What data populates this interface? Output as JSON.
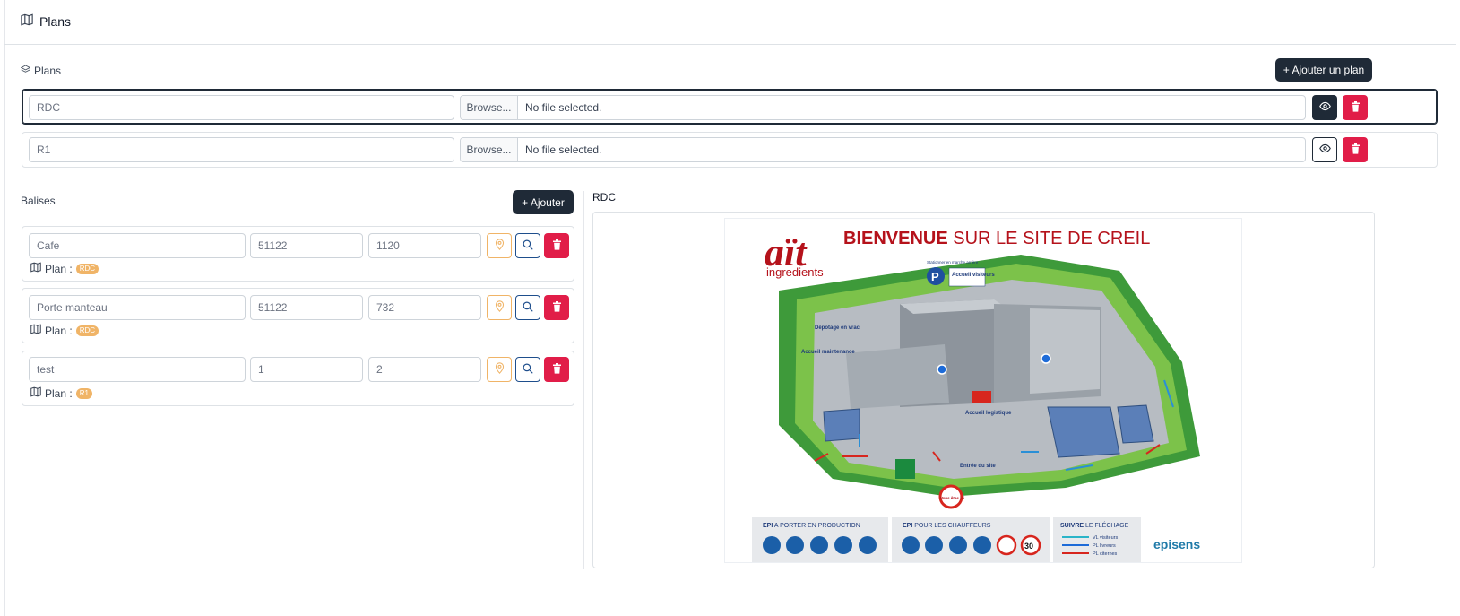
{
  "header": {
    "title": "Plans",
    "icon": "map-icon"
  },
  "plans_section": {
    "label": "Plans",
    "icon": "layers-icon",
    "add_button": "+ Ajouter un plan",
    "rows": [
      {
        "name": "RDC",
        "browse": "Browse...",
        "file": "No file selected.",
        "active": true
      },
      {
        "name": "R1",
        "browse": "Browse...",
        "file": "No file selected.",
        "active": false
      }
    ]
  },
  "tags_section": {
    "label": "Balises",
    "add_button": "+ Ajouter",
    "plan_prefix": "Plan :",
    "items": [
      {
        "name": "Cafe",
        "x": "51122",
        "y": "1120",
        "plan": "RDC"
      },
      {
        "name": "Porte manteau",
        "x": "51122",
        "y": "732",
        "plan": "RDC"
      },
      {
        "name": "test",
        "x": "1",
        "y": "2",
        "plan": "R1"
      }
    ]
  },
  "preview": {
    "title": "RDC",
    "poster": {
      "logo_main": "aït",
      "logo_sub": "ingredients",
      "headline_bold": "BIENVENUE",
      "headline_rest": " SUR LE SITE DE CREIL",
      "labels": {
        "parking": "Stationner en marche arrière",
        "accueil_visiteurs": "Accueil visiteurs",
        "depotage": "Dépotage en vrac",
        "accueil_maintenance": "Accueil maintenance",
        "accueil_logistique": "Accueil logistique",
        "entree": "Entrée du site",
        "vous_etes_ici": "Vous êtes ici"
      },
      "footer": {
        "epi_production_bold": "EPI",
        "epi_production_rest": " A PORTER EN PRODUCTION",
        "epi_chauffeurs_bold": "EPI",
        "epi_chauffeurs_rest": " POUR LES CHAUFFEURS",
        "flechage_bold": "SUIVRE",
        "flechage_rest": " LE FLÉCHAGE",
        "legend": [
          "VL visiteurs",
          "PL livreurs",
          "PL citernes"
        ],
        "speed": "30",
        "brand": "episens"
      }
    }
  },
  "colors": {
    "dark": "#1f2a37",
    "danger": "#e11d48",
    "warning": "#f0b467",
    "primary": "#1e4e8c"
  }
}
